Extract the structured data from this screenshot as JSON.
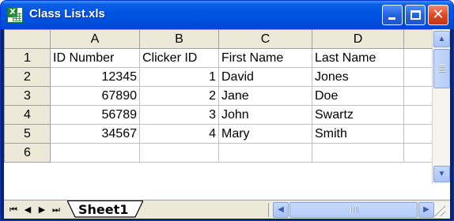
{
  "window": {
    "title": "Class List.xls",
    "buttons": {
      "minimize": "minimize",
      "maximize": "maximize",
      "close": "close"
    }
  },
  "sheet": {
    "column_headers": [
      "A",
      "B",
      "C",
      "D"
    ],
    "row_headers": [
      "1",
      "2",
      "3",
      "4",
      "5",
      "6"
    ],
    "rows": [
      [
        "ID Number",
        "Clicker ID",
        "First Name",
        "Last Name"
      ],
      [
        "12345",
        "1",
        "David",
        "Jones"
      ],
      [
        "67890",
        "2",
        "Jane",
        "Doe"
      ],
      [
        "56789",
        "3",
        "John",
        "Swartz"
      ],
      [
        "34567",
        "4",
        "Mary",
        "Smith"
      ],
      [
        "",
        "",
        "",
        ""
      ]
    ]
  },
  "tabs": {
    "active": "Sheet1",
    "nav": {
      "first": "⏮",
      "prev": "◀",
      "next": "▶",
      "last": "⏭"
    }
  },
  "icons": {
    "app": "excel-sheet-icon",
    "scroll_up": "chevron-up-icon",
    "scroll_down": "chevron-down-icon",
    "scroll_left": "chevron-left-icon",
    "scroll_right": "chevron-right-icon"
  },
  "colors": {
    "title_bar": "#0055e5",
    "close_button": "#df4a24",
    "header_bg": "#ece9d8",
    "gridline": "#c0c0c0"
  }
}
